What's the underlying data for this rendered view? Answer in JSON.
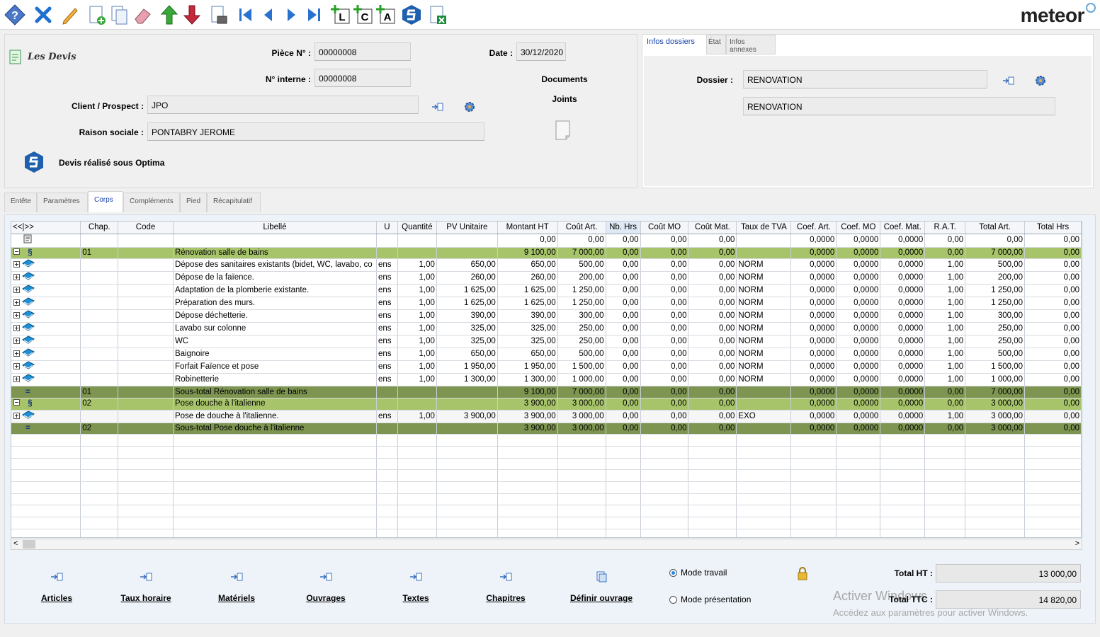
{
  "brand": {
    "name": "meteor"
  },
  "toolbar": {
    "buttons": [
      "help-icon",
      "close-icon",
      "edit-icon",
      "new-document-icon",
      "duplicate-icon",
      "eraser-icon",
      "move-up-icon",
      "move-down-icon",
      "print-preview-icon",
      "first-record-icon",
      "previous-record-icon",
      "next-record-icon",
      "last-record-icon",
      "add-line-l-icon",
      "add-line-c-icon",
      "add-line-a-icon",
      "optima-icon",
      "export-excel-icon"
    ],
    "letters": {
      "l": "L",
      "c": "C",
      "a": "A"
    }
  },
  "header": {
    "module_title": "Les Devis",
    "piece_label": "Pièce N° :",
    "piece_value": "00000008",
    "interne_label": "N° interne :",
    "interne_value": "00000008",
    "date_label": "Date :",
    "date_value": "30/12/2020",
    "client_label": "Client / Prospect :",
    "client_value": "JPO",
    "raison_label": "Raison sociale :",
    "raison_value": "PONTABRY JEROME",
    "documents_label_1": "Documents",
    "documents_label_2": "Joints",
    "optima_text": "Devis réalisé sous Optima"
  },
  "right_panel": {
    "tabs": [
      "Infos dossiers",
      "État",
      "Infos annexes"
    ],
    "dossier_label": "Dossier :",
    "dossier_value": "RENOVATION",
    "dossier_desc": "RENOVATION"
  },
  "section_tabs": [
    "Entête",
    "Paramètres",
    "Corps",
    "Compléments",
    "Pied",
    "Récapitulatif"
  ],
  "grid": {
    "nav": "<<|>>",
    "columns": [
      "Chap.",
      "Code",
      "Libellé",
      "U",
      "Quantité",
      "PV Unitaire",
      "Montant HT",
      "Coût Art.",
      "Nb. Hrs",
      "Coût MO",
      "Coût Mat.",
      "Taux de TVA",
      "Coef. Art.",
      "Coef. MO",
      "Coef. Mat.",
      "R.A.T.",
      "Total Art.",
      "Total Hrs"
    ],
    "rows": [
      {
        "type": "doc",
        "marker": "",
        "chap": "",
        "code": "",
        "lib": "",
        "u": "",
        "qte": "",
        "pvu": "",
        "mht": "0,00",
        "cart": "0,00",
        "nbh": "0,00",
        "cmo": "0,00",
        "cmat": "0,00",
        "tva": "",
        "coefa": "0,0000",
        "coefmo": "0,0000",
        "coefmat": "0,0000",
        "rat": "0,00",
        "tart": "0,00",
        "thrs": "0,00"
      },
      {
        "type": "chap",
        "marker": "§",
        "chap": "01",
        "code": "",
        "lib": "Rénovation salle de bains",
        "u": "",
        "qte": "",
        "pvu": "",
        "mht": "9 100,00",
        "cart": "7 000,00",
        "nbh": "0,00",
        "cmo": "0,00",
        "cmat": "0,00",
        "tva": "",
        "coefa": "0,0000",
        "coefmo": "0,0000",
        "coefmat": "0,0000",
        "rat": "0,00",
        "tart": "7 000,00",
        "thrs": "0,00"
      },
      {
        "type": "item",
        "marker": "",
        "chap": "",
        "code": "",
        "lib": "Dépose des sanitaires existants (bidet, WC, lavabo, co",
        "u": "ens",
        "qte": "1,00",
        "pvu": "650,00",
        "mht": "650,00",
        "cart": "500,00",
        "nbh": "0,00",
        "cmo": "0,00",
        "cmat": "0,00",
        "tva": "NORM",
        "coefa": "0,0000",
        "coefmo": "0,0000",
        "coefmat": "0,0000",
        "rat": "1,00",
        "tart": "500,00",
        "thrs": "0,00"
      },
      {
        "type": "item",
        "marker": "",
        "chap": "",
        "code": "",
        "lib": "Dépose de la faïence.",
        "u": "ens",
        "qte": "1,00",
        "pvu": "260,00",
        "mht": "260,00",
        "cart": "200,00",
        "nbh": "0,00",
        "cmo": "0,00",
        "cmat": "0,00",
        "tva": "NORM",
        "coefa": "0,0000",
        "coefmo": "0,0000",
        "coefmat": "0,0000",
        "rat": "1,00",
        "tart": "200,00",
        "thrs": "0,00"
      },
      {
        "type": "item",
        "marker": "",
        "chap": "",
        "code": "",
        "lib": "Adaptation de la plomberie existante.",
        "u": "ens",
        "qte": "1,00",
        "pvu": "1 625,00",
        "mht": "1 625,00",
        "cart": "1 250,00",
        "nbh": "0,00",
        "cmo": "0,00",
        "cmat": "0,00",
        "tva": "NORM",
        "coefa": "0,0000",
        "coefmo": "0,0000",
        "coefmat": "0,0000",
        "rat": "1,00",
        "tart": "1 250,00",
        "thrs": "0,00"
      },
      {
        "type": "item",
        "marker": "",
        "chap": "",
        "code": "",
        "lib": "Préparation des murs.",
        "u": "ens",
        "qte": "1,00",
        "pvu": "1 625,00",
        "mht": "1 625,00",
        "cart": "1 250,00",
        "nbh": "0,00",
        "cmo": "0,00",
        "cmat": "0,00",
        "tva": "NORM",
        "coefa": "0,0000",
        "coefmo": "0,0000",
        "coefmat": "0,0000",
        "rat": "1,00",
        "tart": "1 250,00",
        "thrs": "0,00"
      },
      {
        "type": "item",
        "marker": "",
        "chap": "",
        "code": "",
        "lib": "Dépose déchetterie.",
        "u": "ens",
        "qte": "1,00",
        "pvu": "390,00",
        "mht": "390,00",
        "cart": "300,00",
        "nbh": "0,00",
        "cmo": "0,00",
        "cmat": "0,00",
        "tva": "NORM",
        "coefa": "0,0000",
        "coefmo": "0,0000",
        "coefmat": "0,0000",
        "rat": "1,00",
        "tart": "300,00",
        "thrs": "0,00"
      },
      {
        "type": "item",
        "marker": "",
        "chap": "",
        "code": "",
        "lib": "Lavabo sur colonne",
        "u": "ens",
        "qte": "1,00",
        "pvu": "325,00",
        "mht": "325,00",
        "cart": "250,00",
        "nbh": "0,00",
        "cmo": "0,00",
        "cmat": "0,00",
        "tva": "NORM",
        "coefa": "0,0000",
        "coefmo": "0,0000",
        "coefmat": "0,0000",
        "rat": "1,00",
        "tart": "250,00",
        "thrs": "0,00"
      },
      {
        "type": "item",
        "marker": "",
        "chap": "",
        "code": "",
        "lib": "WC",
        "u": "ens",
        "qte": "1,00",
        "pvu": "325,00",
        "mht": "325,00",
        "cart": "250,00",
        "nbh": "0,00",
        "cmo": "0,00",
        "cmat": "0,00",
        "tva": "NORM",
        "coefa": "0,0000",
        "coefmo": "0,0000",
        "coefmat": "0,0000",
        "rat": "1,00",
        "tart": "250,00",
        "thrs": "0,00"
      },
      {
        "type": "item",
        "marker": "",
        "chap": "",
        "code": "",
        "lib": "Baignoire",
        "u": "ens",
        "qte": "1,00",
        "pvu": "650,00",
        "mht": "650,00",
        "cart": "500,00",
        "nbh": "0,00",
        "cmo": "0,00",
        "cmat": "0,00",
        "tva": "NORM",
        "coefa": "0,0000",
        "coefmo": "0,0000",
        "coefmat": "0,0000",
        "rat": "1,00",
        "tart": "500,00",
        "thrs": "0,00"
      },
      {
        "type": "item",
        "marker": "",
        "chap": "",
        "code": "",
        "lib": "Forfait Faïence et pose",
        "u": "ens",
        "qte": "1,00",
        "pvu": "1 950,00",
        "mht": "1 950,00",
        "cart": "1 500,00",
        "nbh": "0,00",
        "cmo": "0,00",
        "cmat": "0,00",
        "tva": "NORM",
        "coefa": "0,0000",
        "coefmo": "0,0000",
        "coefmat": "0,0000",
        "rat": "1,00",
        "tart": "1 500,00",
        "thrs": "0,00"
      },
      {
        "type": "item",
        "marker": "",
        "chap": "",
        "code": "",
        "lib": "Robinetterie",
        "u": "ens",
        "qte": "1,00",
        "pvu": "1 300,00",
        "mht": "1 300,00",
        "cart": "1 000,00",
        "nbh": "0,00",
        "cmo": "0,00",
        "cmat": "0,00",
        "tva": "NORM",
        "coefa": "0,0000",
        "coefmo": "0,0000",
        "coefmat": "0,0000",
        "rat": "1,00",
        "tart": "1 000,00",
        "thrs": "0,00"
      },
      {
        "type": "sub",
        "marker": "=",
        "chap": "01",
        "code": "",
        "lib": "Sous-total Rénovation salle de bains",
        "u": "",
        "qte": "",
        "pvu": "",
        "mht": "9 100,00",
        "cart": "7 000,00",
        "nbh": "0,00",
        "cmo": "0,00",
        "cmat": "0,00",
        "tva": "",
        "coefa": "0,0000",
        "coefmo": "0,0000",
        "coefmat": "0,0000",
        "rat": "0,00",
        "tart": "7 000,00",
        "thrs": "0,00"
      },
      {
        "type": "chap",
        "marker": "§",
        "chap": "02",
        "code": "",
        "lib": "Pose douche à l'italienne",
        "u": "",
        "qte": "",
        "pvu": "",
        "mht": "3 900,00",
        "cart": "3 000,00",
        "nbh": "0,00",
        "cmo": "0,00",
        "cmat": "0,00",
        "tva": "",
        "coefa": "0,0000",
        "coefmo": "0,0000",
        "coefmat": "0,0000",
        "rat": "0,00",
        "tart": "3 000,00",
        "thrs": "0,00"
      },
      {
        "type": "sel",
        "marker": "",
        "chap": "",
        "code": "",
        "lib": "Pose de douche à l'italienne.",
        "u": "ens",
        "qte": "1,00",
        "pvu": "3 900,00",
        "mht": "3 900,00",
        "cart": "3 000,00",
        "nbh": "0,00",
        "cmo": "0,00",
        "cmat": "0,00",
        "tva": "EXO",
        "coefa": "0,0000",
        "coefmo": "0,0000",
        "coefmat": "0,0000",
        "rat": "1,00",
        "tart": "3 000,00",
        "thrs": "0,00"
      },
      {
        "type": "sub",
        "marker": "=",
        "chap": "02",
        "code": "",
        "lib": "Sous-total Pose douche à l'italienne",
        "u": "",
        "qte": "",
        "pvu": "",
        "mht": "3 900,00",
        "cart": "3 000,00",
        "nbh": "0,00",
        "cmo": "0,00",
        "cmat": "0,00",
        "tva": "",
        "coefa": "0,0000",
        "coefmo": "0,0000",
        "coefmat": "0,0000",
        "rat": "0,00",
        "tart": "3 000,00",
        "thrs": "0,00"
      }
    ]
  },
  "bottom": {
    "buttons": [
      "Articles",
      "Taux horaire",
      "Matériels",
      "Ouvrages",
      "Textes",
      "Chapitres",
      "Définir ouvrage"
    ],
    "mode_travail": "Mode travail",
    "mode_presentation": "Mode présentation",
    "total_ht_label": "Total HT :",
    "total_ht_value": "13 000,00",
    "total_ttc_label": "Total TTC :",
    "total_ttc_value": "14 820,00"
  },
  "watermark": {
    "line1": "Activer Windows",
    "line2": "Accédez aux paramètres pour activer Windows."
  },
  "colors": {
    "chapter_row": "#a7c46a",
    "subtotal_row": "#7d9550",
    "accent": "#1a44b0"
  }
}
